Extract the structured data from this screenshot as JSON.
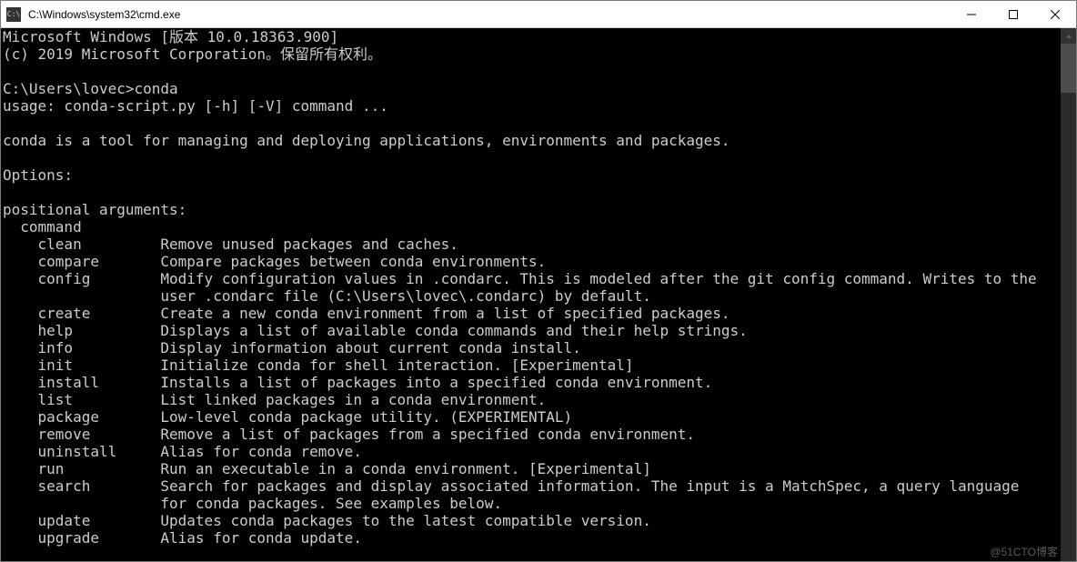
{
  "window": {
    "title": "C:\\Windows\\system32\\cmd.exe",
    "icon_label": "C:\\"
  },
  "terminal": {
    "header": {
      "line1": "Microsoft Windows [版本 10.0.18363.900]",
      "line2": "(c) 2019 Microsoft Corporation。保留所有权利。"
    },
    "prompt": {
      "path": "C:\\Users\\lovec>",
      "command": "conda"
    },
    "usage": "usage: conda-script.py [-h] [-V] command ...",
    "description": "conda is a tool for managing and deploying applications, environments and packages.",
    "options_label": "Options:",
    "pos_args_label": "positional arguments:",
    "command_label": "  command",
    "commands": [
      {
        "name": "clean",
        "desc": "Remove unused packages and caches."
      },
      {
        "name": "compare",
        "desc": "Compare packages between conda environments."
      },
      {
        "name": "config",
        "desc": "Modify configuration values in .condarc. This is modeled after the git config command. Writes to the\n                  user .condarc file (C:\\Users\\lovec\\.condarc) by default."
      },
      {
        "name": "create",
        "desc": "Create a new conda environment from a list of specified packages."
      },
      {
        "name": "help",
        "desc": "Displays a list of available conda commands and their help strings."
      },
      {
        "name": "info",
        "desc": "Display information about current conda install."
      },
      {
        "name": "init",
        "desc": "Initialize conda for shell interaction. [Experimental]"
      },
      {
        "name": "install",
        "desc": "Installs a list of packages into a specified conda environment."
      },
      {
        "name": "list",
        "desc": "List linked packages in a conda environment."
      },
      {
        "name": "package",
        "desc": "Low-level conda package utility. (EXPERIMENTAL)"
      },
      {
        "name": "remove",
        "desc": "Remove a list of packages from a specified conda environment."
      },
      {
        "name": "uninstall",
        "desc": "Alias for conda remove."
      },
      {
        "name": "run",
        "desc": "Run an executable in a conda environment. [Experimental]"
      },
      {
        "name": "search",
        "desc": "Search for packages and display associated information. The input is a MatchSpec, a query language\n                  for conda packages. See examples below."
      },
      {
        "name": "update",
        "desc": "Updates conda packages to the latest compatible version."
      },
      {
        "name": "upgrade",
        "desc": "Alias for conda update."
      }
    ]
  },
  "watermark": "@51CTO博客"
}
